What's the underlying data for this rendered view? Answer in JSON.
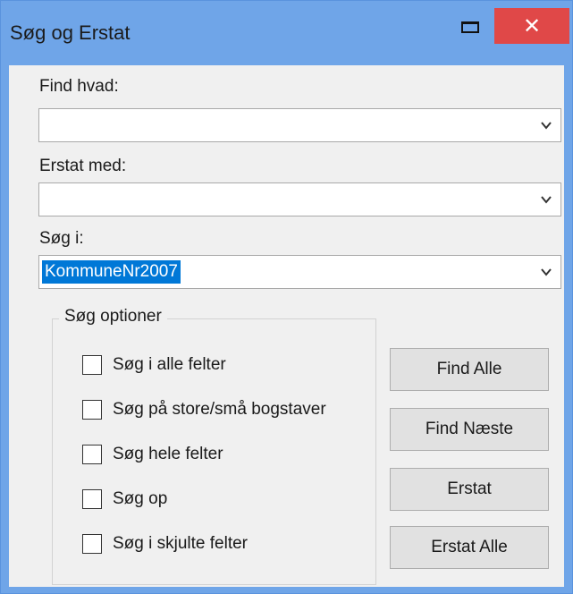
{
  "window": {
    "title": "Søg og Erstat",
    "close_glyph": "✕"
  },
  "find": {
    "label": "Find hvad:",
    "value": ""
  },
  "replace": {
    "label": "Erstat med:",
    "value": ""
  },
  "search_in": {
    "label": "Søg i:",
    "value": "KommuneNr2007"
  },
  "options": {
    "legend": "Søg optioner",
    "items": [
      {
        "label": "Søg i alle felter",
        "checked": false
      },
      {
        "label": "Søg på store/små bogstaver",
        "checked": false
      },
      {
        "label": "Søg hele felter",
        "checked": false
      },
      {
        "label": "Søg op",
        "checked": false
      },
      {
        "label": "Søg i skjulte felter",
        "checked": false
      }
    ]
  },
  "buttons": {
    "find_all": "Find Alle",
    "find_next": "Find Næste",
    "replace": "Erstat",
    "replace_all": "Erstat Alle"
  },
  "colors": {
    "titlebar": "#6fa5e8",
    "close": "#e04848",
    "selection": "#0078d7",
    "dialog_bg": "#f0f0f0"
  }
}
